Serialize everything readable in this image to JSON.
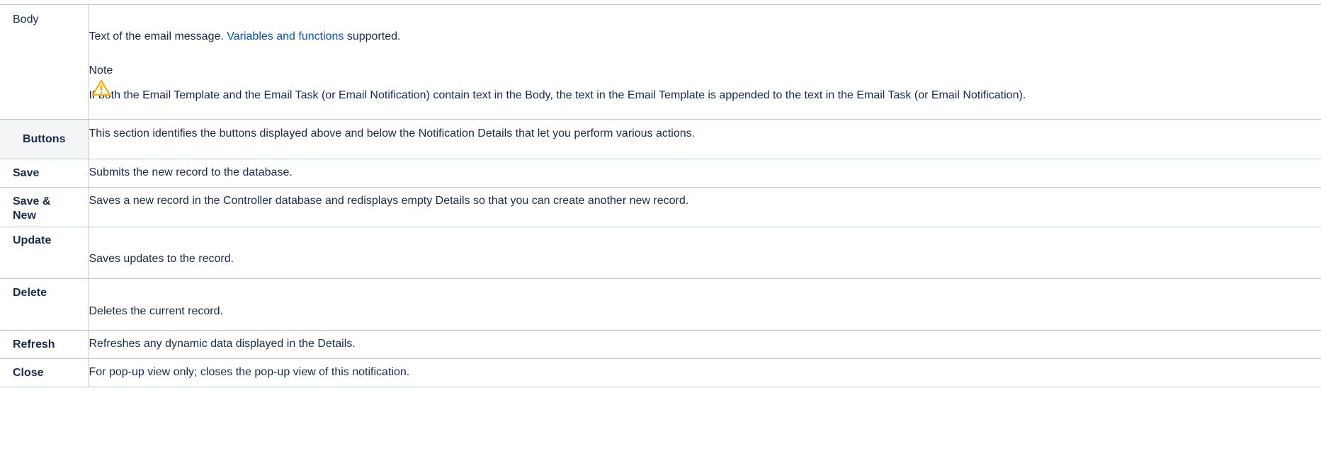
{
  "rows": [
    {
      "label": "Body",
      "description_prefix": "Text of the email message. ",
      "description_link": "Variables and functions",
      "description_suffix": " supported.",
      "note": {
        "title": "Note",
        "icon": "warning-icon",
        "text": "If both the Email Template and the Email Task (or Email Notification) contain text in the Body, the text in the Email Template is appended to the text in the Email Task (or Email Notification)."
      }
    },
    {
      "label": "Buttons",
      "description": "This section identifies the buttons displayed above and below the Notification Details that let you perform various actions."
    },
    {
      "label": "Save",
      "description": "Submits the new record to the database."
    },
    {
      "label": "Save & New",
      "description": "Saves a new record in the Controller database and redisplays empty Details so that you can create another new record."
    },
    {
      "label": "Update",
      "description": "Saves updates to the record."
    },
    {
      "label": "Delete",
      "description": "Deletes the current record."
    },
    {
      "label": "Refresh",
      "description": "Refreshes any dynamic data displayed in the Details."
    },
    {
      "label": "Close",
      "description": "For pop-up view only; closes the pop-up view of this notification."
    }
  ],
  "colors": {
    "text": "#172b4d",
    "link": "#0052cc",
    "border": "#c1c7d0",
    "section_header_bg": "#f4f5f7",
    "warning_icon": "#ffab00"
  }
}
